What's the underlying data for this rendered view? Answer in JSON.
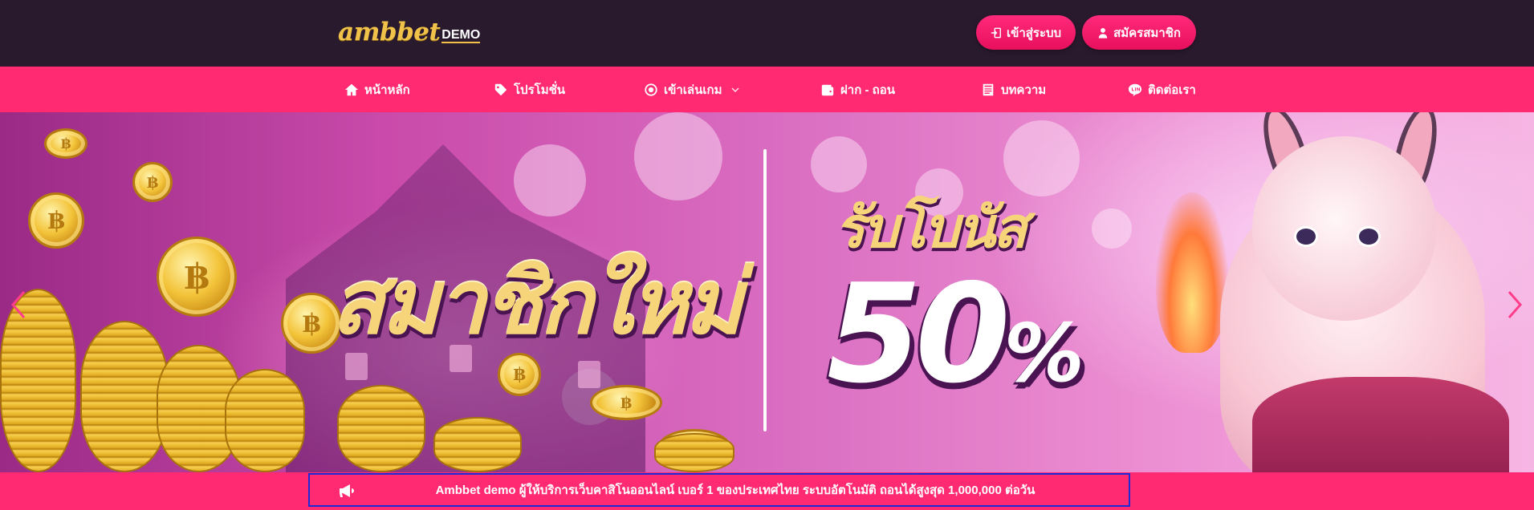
{
  "header": {
    "logo_main": "ambbet",
    "logo_sub": "DEMO",
    "login_label": "เข้าสู่ระบบ",
    "register_label": "สมัครสมาชิก"
  },
  "nav": {
    "items": [
      {
        "label": "หน้าหลัก",
        "icon": "home-icon"
      },
      {
        "label": "โปรโมชั่น",
        "icon": "tag-icon"
      },
      {
        "label": "เข้าเล่นเกม",
        "icon": "gear-icon"
      },
      {
        "label": "ฝาก - ถอน",
        "icon": "wallet-icon"
      },
      {
        "label": "บทความ",
        "icon": "article-icon"
      },
      {
        "label": "ติดต่อเรา",
        "icon": "line-icon"
      }
    ]
  },
  "banner": {
    "headline": "สมาชิกใหม่",
    "bonus_label": "รับโบนัส",
    "bonus_value": "50",
    "bonus_unit": "%"
  },
  "announcement": {
    "text": "Ambbet demo ผู้ให้บริการเว็บคาสิโนออนไลน์ เบอร์ 1 ของประเทศไทย ระบบอัตโนมัติ ถอนได้สูงสุด 1,000,000 ต่อวัน"
  },
  "colors": {
    "header_bg": "#2a1a2e",
    "accent": "#ff2a72",
    "logo_gold": "#f0c24a",
    "announcement_border": "#1d2bd6"
  }
}
